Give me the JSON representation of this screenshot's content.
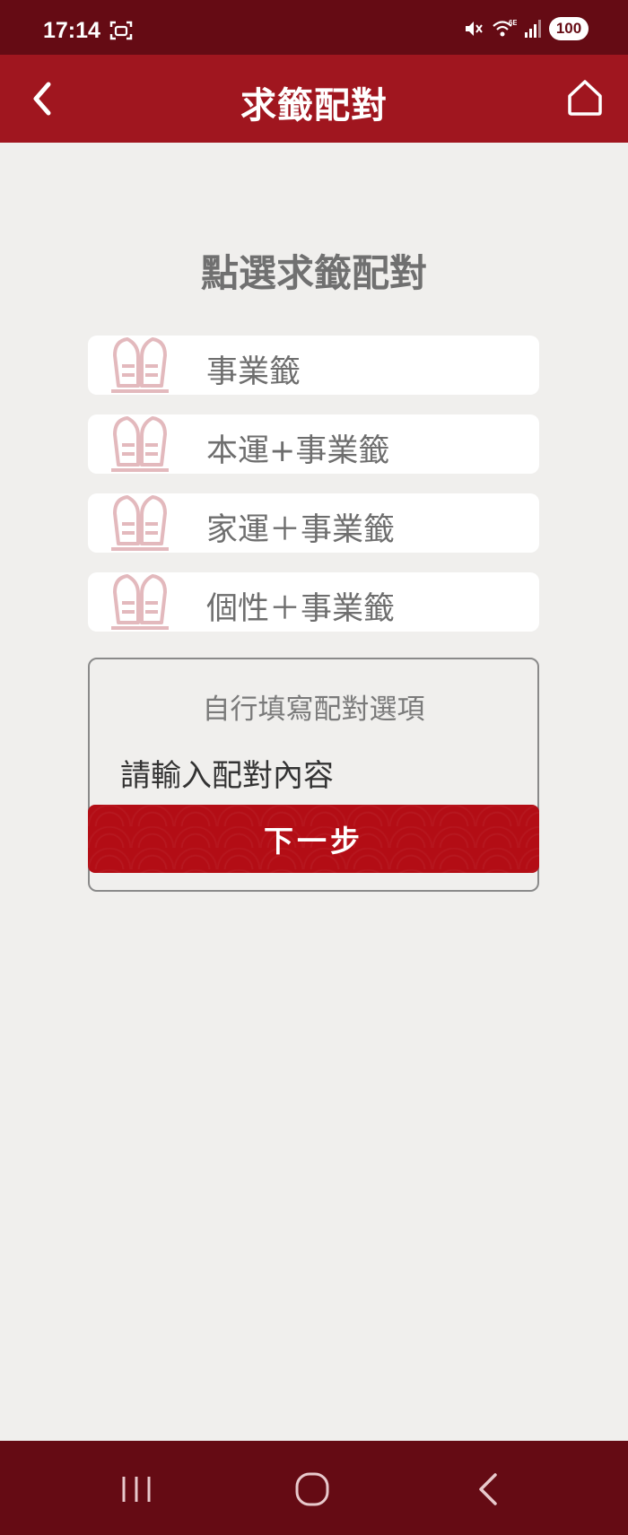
{
  "status_bar": {
    "time": "17:14",
    "battery": "100"
  },
  "header": {
    "title": "求籤配對",
    "back_icon": "chevron-left-icon",
    "home_icon": "home-icon"
  },
  "main": {
    "prompt_title": "點選求籤配對",
    "options": [
      {
        "label": "事業籤",
        "icon": "lot-slip-icon"
      },
      {
        "label": "本運+事業籤",
        "icon": "lot-slip-icon"
      },
      {
        "label": "家運＋事業籤",
        "icon": "lot-slip-icon"
      },
      {
        "label": "個性＋事業籤",
        "icon": "lot-slip-icon"
      }
    ],
    "custom": {
      "title": "自行填寫配對選項",
      "input_placeholder": "請輸入配對內容",
      "input_value": "",
      "next_label": "下一步"
    }
  },
  "colors": {
    "status_bar_bg": "#650b14",
    "header_bg": "#a0161f",
    "button_bg": "#b30d15",
    "icon_pink": "#e3b9bd",
    "content_bg": "#f0efed"
  }
}
